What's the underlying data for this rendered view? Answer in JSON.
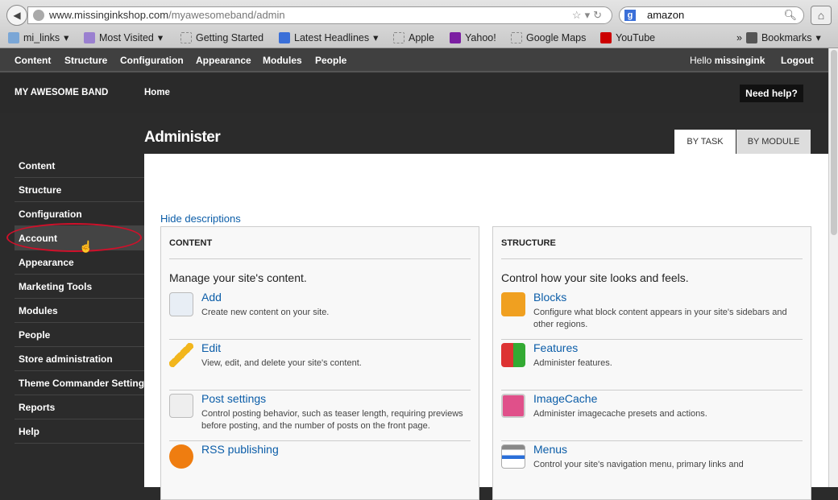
{
  "browser": {
    "url_host": "www.missinginkshop.com",
    "url_path": "/myawesomeband/admin",
    "search_value": "amazon",
    "bookmarks": [
      "mi_links",
      "Most Visited",
      "Getting Started",
      "Latest Headlines",
      "Apple",
      "Yahoo!",
      "Google Maps",
      "YouTube"
    ],
    "bookmarks_menu": "Bookmarks"
  },
  "toolbar": {
    "items": [
      "Content",
      "Structure",
      "Configuration",
      "Appearance",
      "Modules",
      "People"
    ],
    "greeting": "Hello ",
    "user": "missingink",
    "logout": "Logout"
  },
  "header": {
    "site_name": "MY AWESOME BAND",
    "home": "Home",
    "help": "Need help?"
  },
  "page": {
    "title": "Administer",
    "tabs": [
      "BY TASK",
      "BY MODULE"
    ],
    "hide_descriptions": "Hide descriptions"
  },
  "sidebar": {
    "items": [
      "Content",
      "Structure",
      "Configuration",
      "Account",
      "Appearance",
      "Marketing Tools",
      "Modules",
      "People",
      "Store administration",
      "Theme Commander Settings",
      "Reports",
      "Help"
    ],
    "active": "Account"
  },
  "panels": [
    {
      "heading": "CONTENT",
      "description": "Manage your site's content.",
      "entries": [
        {
          "title": "Add",
          "desc": "Create new content on your site.",
          "icon": "add-document-icon"
        },
        {
          "title": "Edit",
          "desc": "View, edit, and delete your site's content.",
          "icon": "pencil-icon"
        },
        {
          "title": "Post settings",
          "desc": "Control posting behavior, such as teaser length, requiring previews before posting, and the number of posts on the front page.",
          "icon": "document-wrench-icon"
        },
        {
          "title": "RSS publishing",
          "desc": "",
          "icon": "rss-gear-icon"
        }
      ]
    },
    {
      "heading": "STRUCTURE",
      "description": "Control how your site looks and feels.",
      "entries": [
        {
          "title": "Blocks",
          "desc": "Configure what block content appears in your site's sidebars and other regions.",
          "icon": "blocks-icon"
        },
        {
          "title": "Features",
          "desc": "Administer features.",
          "icon": "features-icon"
        },
        {
          "title": "ImageCache",
          "desc": "Administer imagecache presets and actions.",
          "icon": "imagecache-icon"
        },
        {
          "title": "Menus",
          "desc": "Control your site's navigation menu, primary links and",
          "icon": "menus-icon"
        }
      ]
    }
  ],
  "colors": {
    "accent_link": "#0b5da8",
    "highlight_ring": "#d0102a"
  }
}
